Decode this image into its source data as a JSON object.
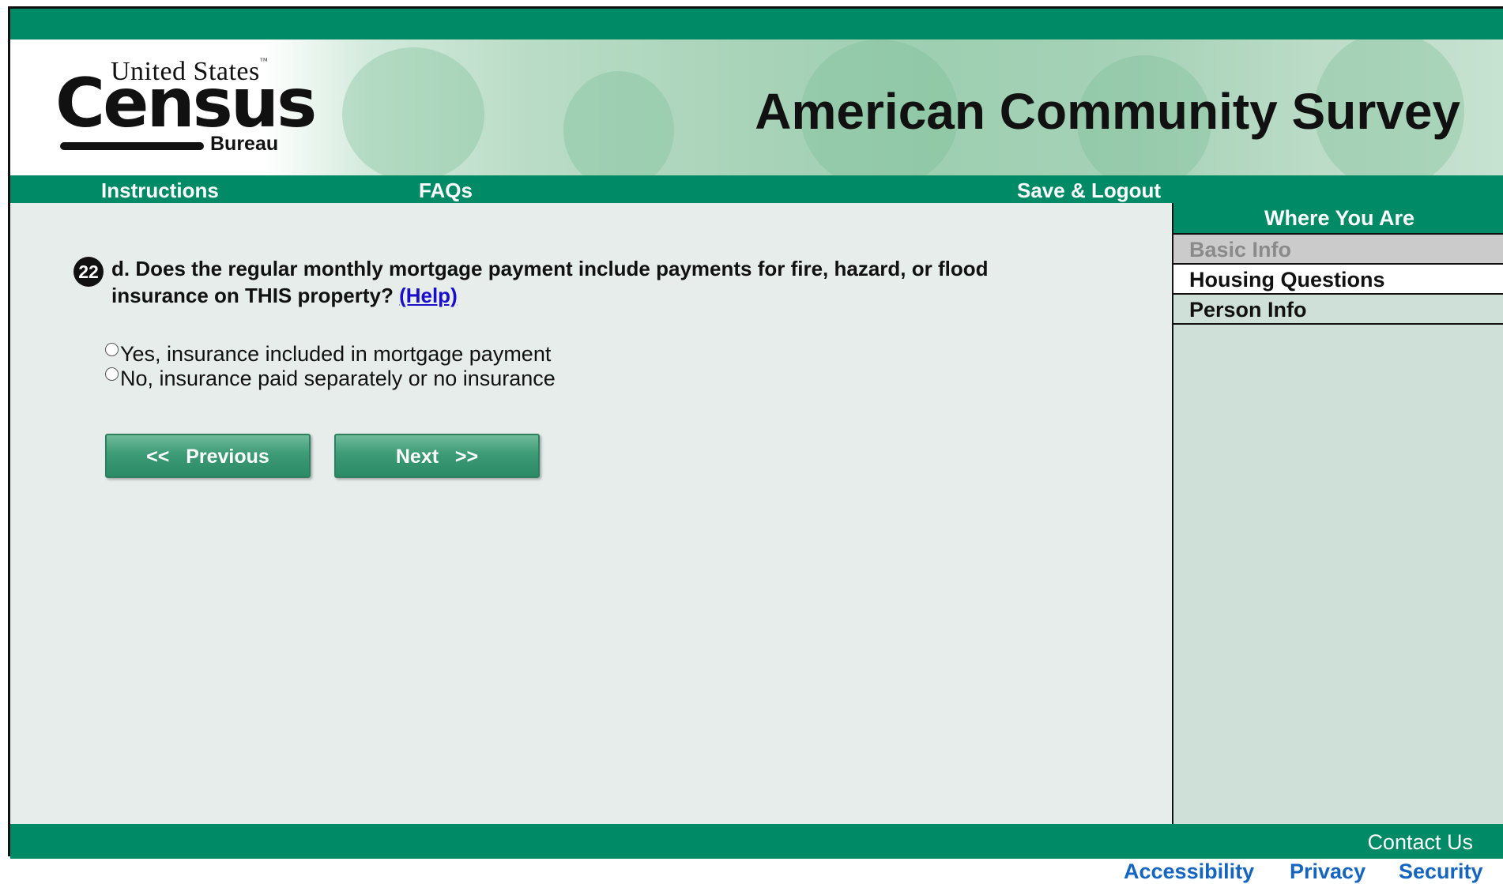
{
  "header": {
    "logo_top": "United States",
    "logo_tm": "™",
    "logo_main": "Census",
    "logo_bottom": "Bureau",
    "title": "American Community Survey"
  },
  "nav": {
    "instructions": "Instructions",
    "faqs": "FAQs",
    "save_logout": "Save & Logout"
  },
  "question": {
    "number": "22",
    "text": "d. Does the regular monthly mortgage payment include payments for fire, hazard, or flood insurance on THIS property?",
    "help_label": "(Help)",
    "options": [
      "Yes, insurance included in mortgage payment",
      "No, insurance paid separately or no insurance"
    ]
  },
  "buttons": {
    "previous": "<<   Previous",
    "next": "Next   >>"
  },
  "sidebar": {
    "heading": "Where You Are",
    "items": [
      {
        "label": "Basic Info",
        "state": "disabled"
      },
      {
        "label": "Housing Questions",
        "state": "current"
      },
      {
        "label": "Person Info",
        "state": "default"
      }
    ]
  },
  "footer": {
    "contact": "Contact Us",
    "links": [
      "Accessibility",
      "Privacy",
      "Security"
    ]
  },
  "colors": {
    "brand_green": "#008a66",
    "link_blue": "#1565c0",
    "panel_bg": "#e6edea"
  }
}
